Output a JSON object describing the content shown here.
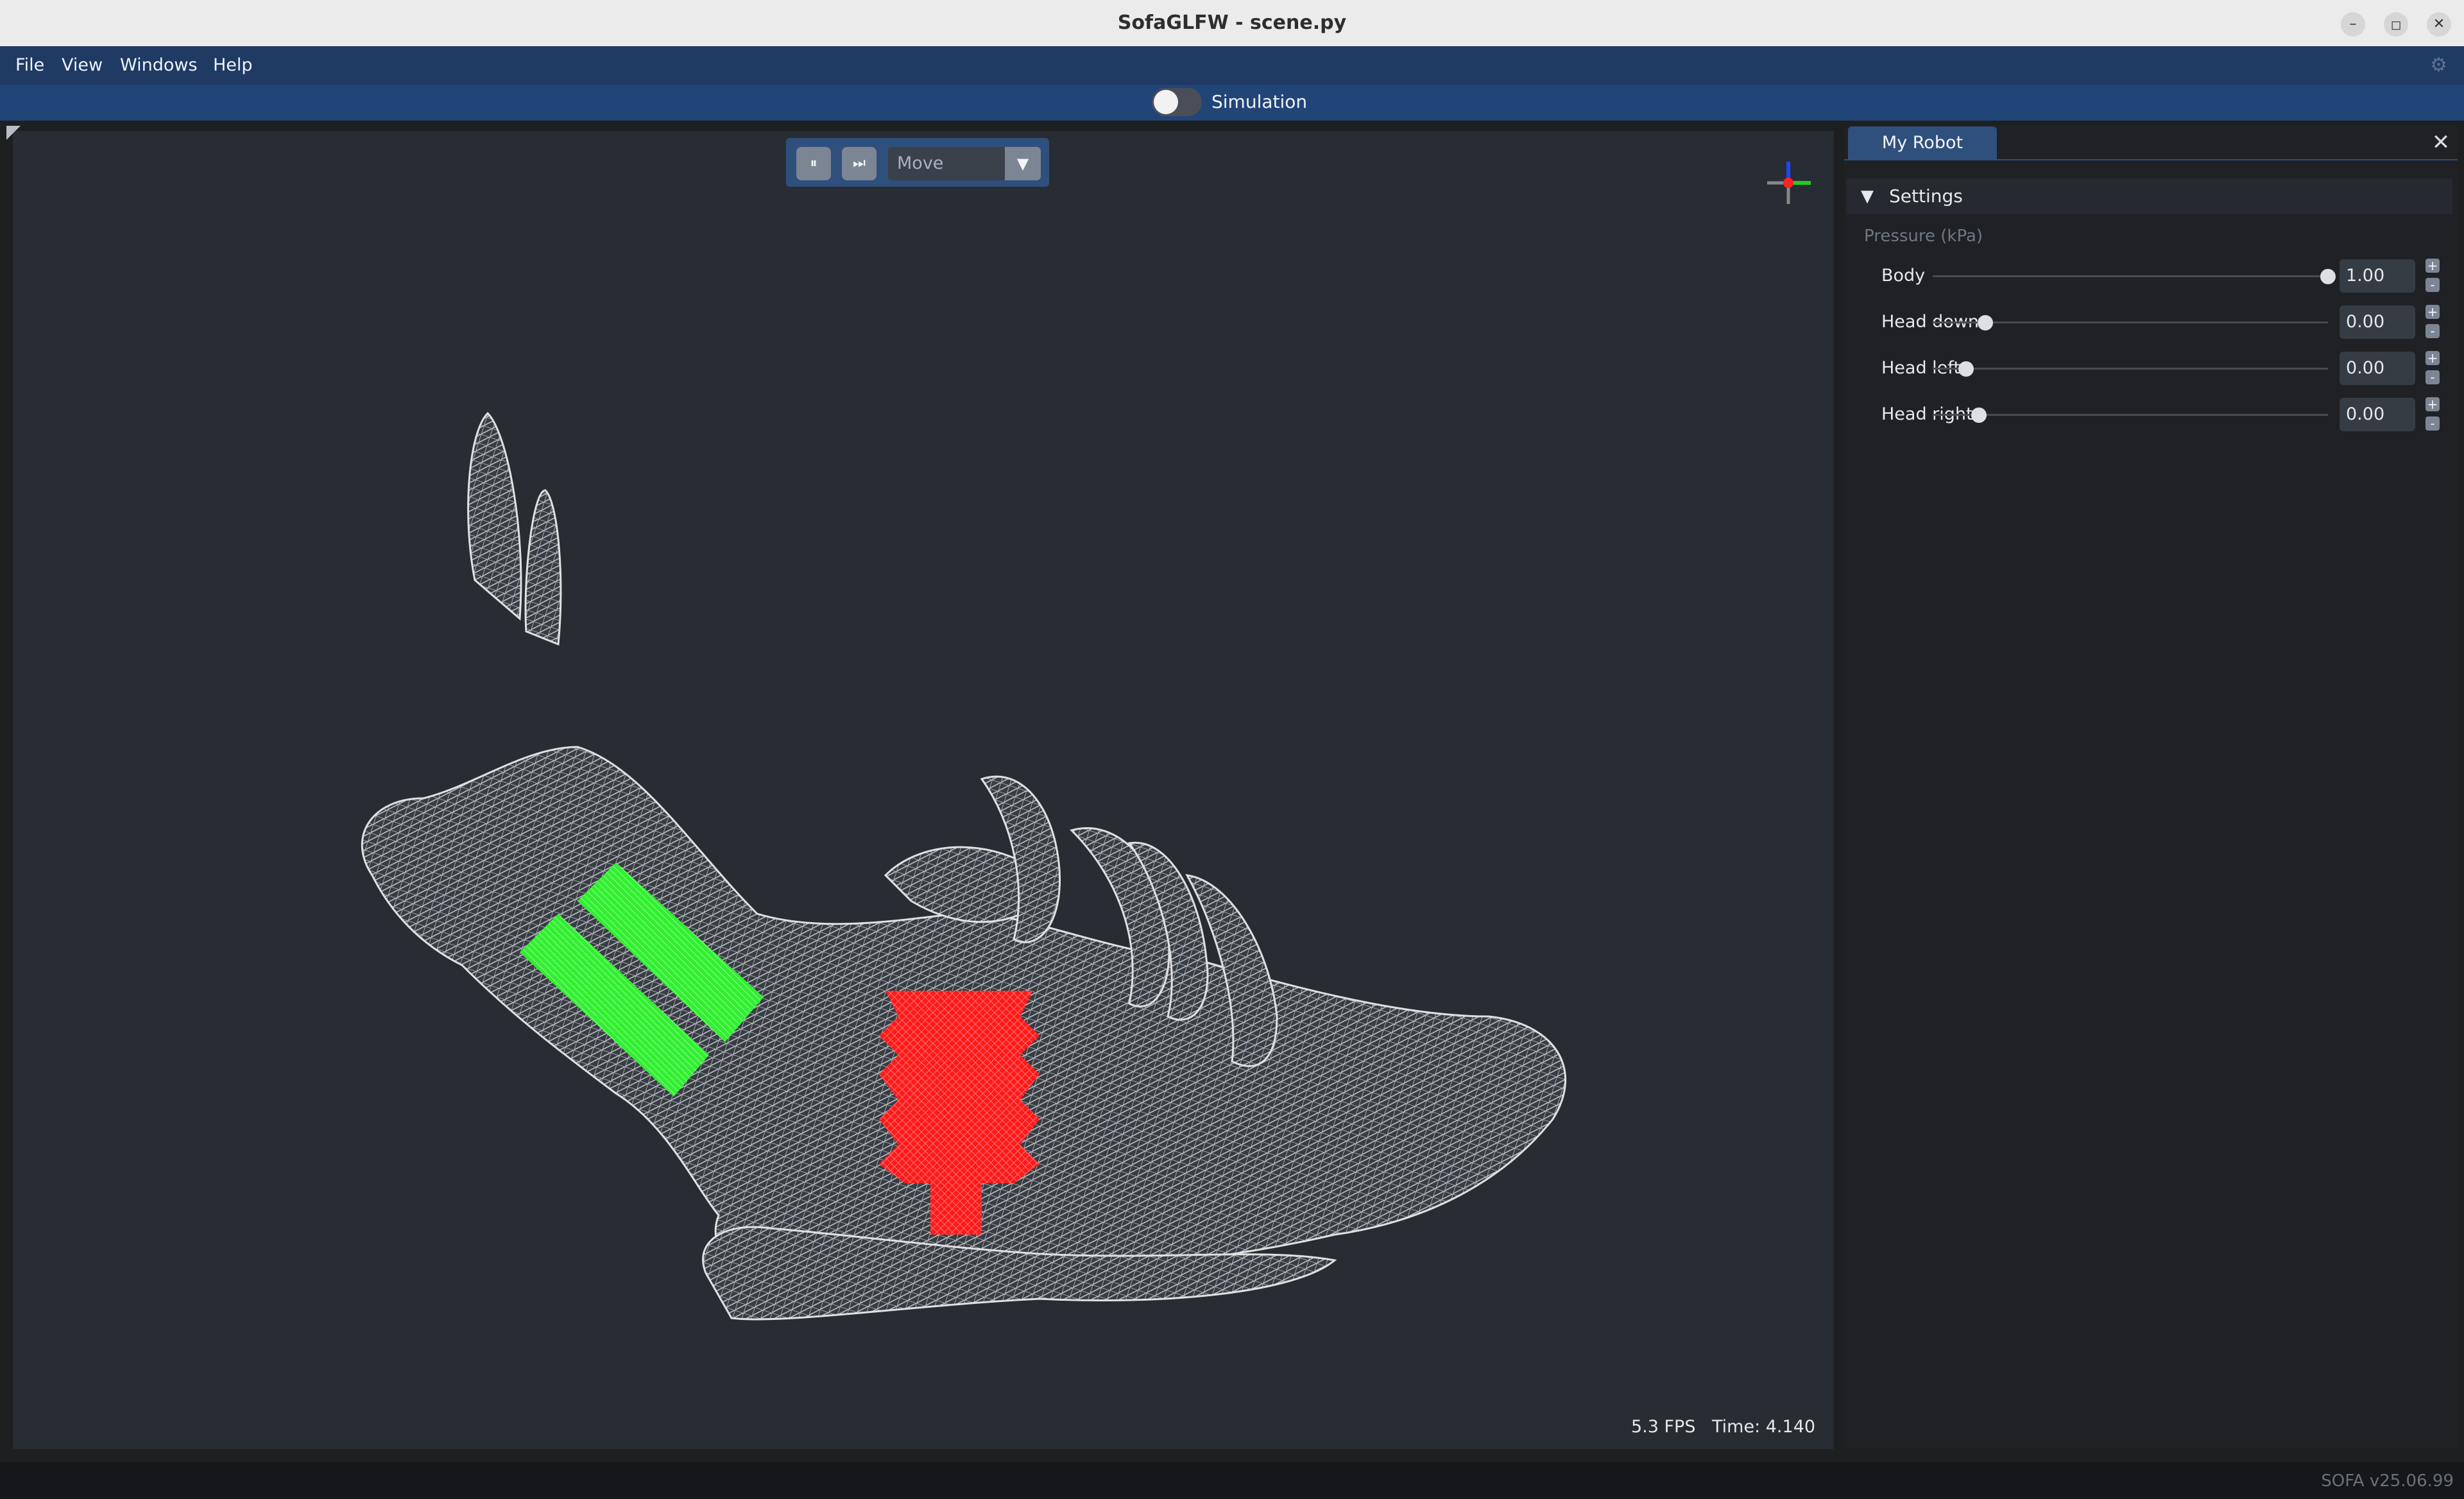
{
  "window": {
    "title": "SofaGLFW - scene.py",
    "minimize_glyph": "–",
    "maximize_glyph": "◻",
    "close_glyph": "✕"
  },
  "menu": {
    "items": [
      "File",
      "View",
      "Windows",
      "Help"
    ],
    "settings_icon": "gear-icon"
  },
  "simulation": {
    "label": "Simulation",
    "enabled": false
  },
  "viewport": {
    "controls": {
      "pause_glyph": "⏸",
      "step_glyph": "⏭",
      "mode": "Move",
      "mode_dropdown_glyph": "▼"
    },
    "fps": "5.3 FPS",
    "time": "Time: 4.140",
    "colors": {
      "mesh": "#d9d9d9",
      "actuator_body": "#ff1a1a",
      "actuator_head": "#33ff33"
    }
  },
  "panel": {
    "tab": "My Robot",
    "close_glyph": "✕",
    "section": {
      "title": "Settings",
      "expand_glyph": "▼"
    },
    "group_label": "Pressure (kPa)",
    "sliders": [
      {
        "label": "Body",
        "value": "1.00",
        "fraction": 1.0
      },
      {
        "label": "Head down",
        "value": "0.00",
        "fraction": 0.0
      },
      {
        "label": "Head left",
        "value": "0.00",
        "fraction": 0.0
      },
      {
        "label": "Head right",
        "value": "0.00",
        "fraction": 0.0
      }
    ],
    "stepper_plus": "+",
    "stepper_minus": "-"
  },
  "footer": {
    "version": "SOFA v25.06.99"
  }
}
